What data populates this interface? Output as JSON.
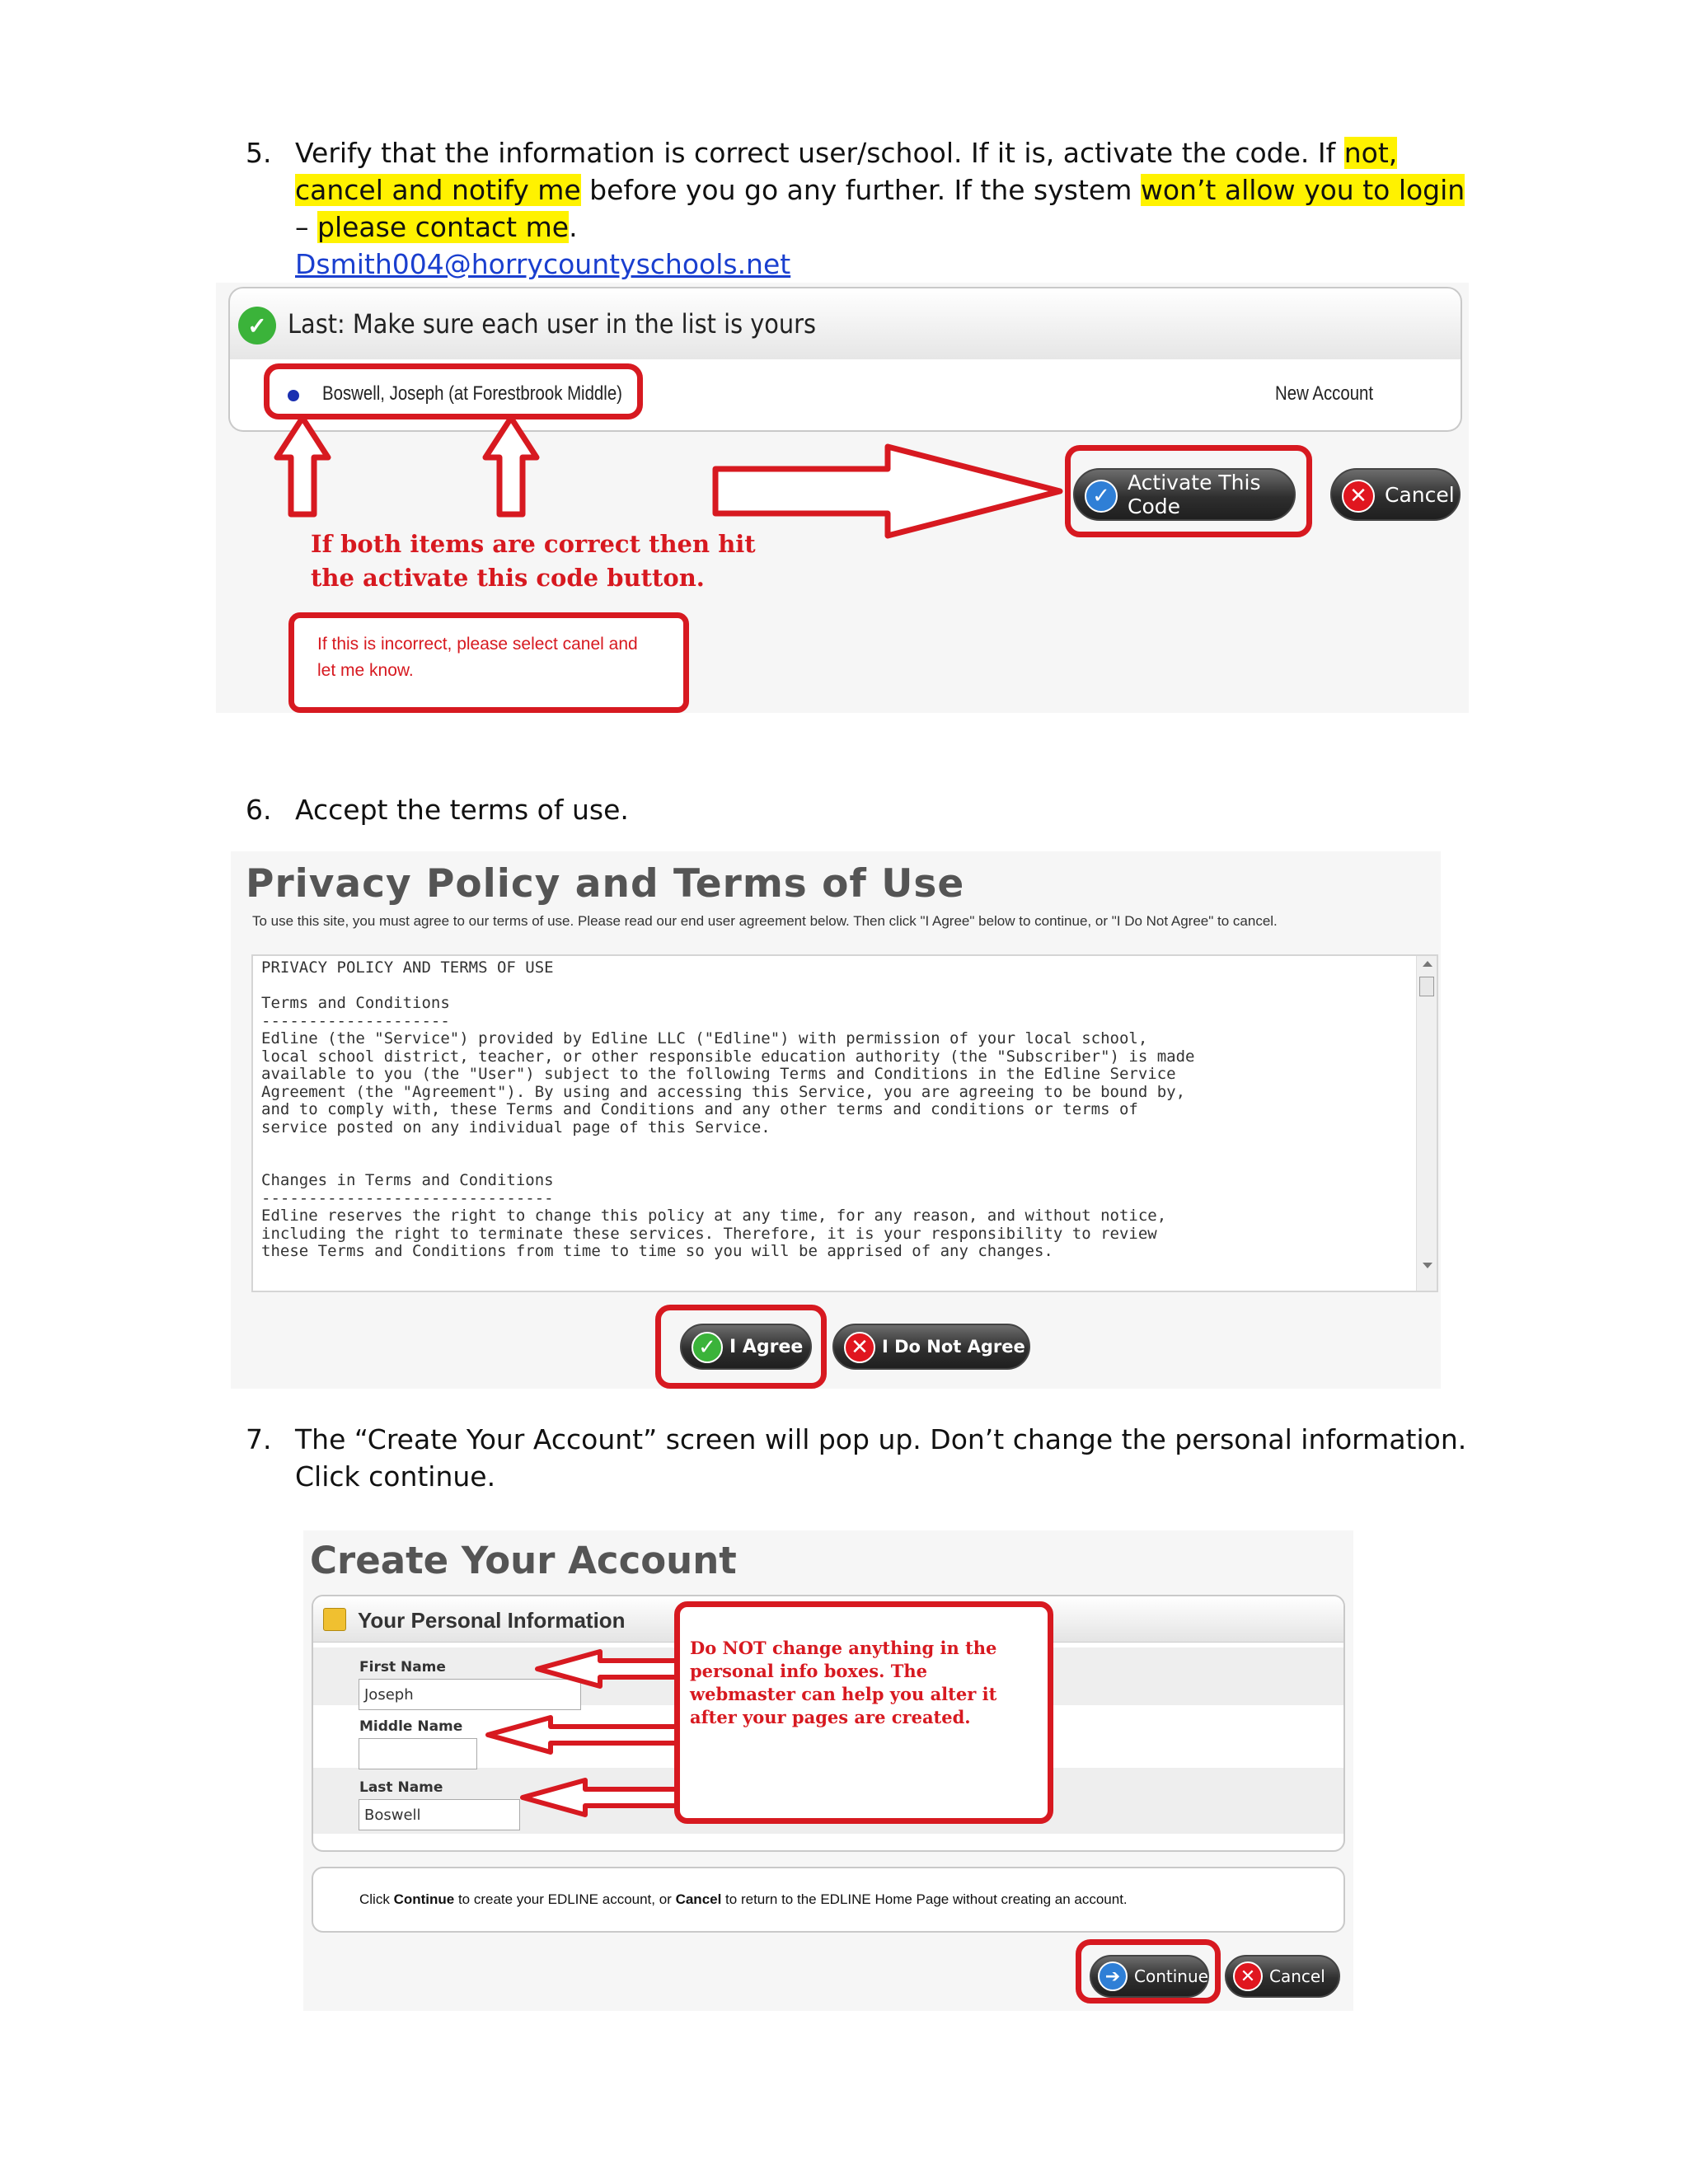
{
  "step5": {
    "number": "5.",
    "text_a": "Verify that the information is correct user/school.  If it is, activate the code. If ",
    "hl_a": "not, cancel and notify me",
    "text_b": " before you go any further. If the system ",
    "hl_b": "won’t allow you to login",
    "text_c": " – ",
    "hl_c": "please contact me",
    "text_d": ".",
    "email": "Dsmith004@horrycountyschools.net"
  },
  "shot1": {
    "header": "Last: Make sure each user in the list is yours",
    "user": "Boswell, Joseph (at Forestbrook Middle)",
    "status": "New Account",
    "activate_label": "Activate This Code",
    "cancel_label": "Cancel",
    "note_line1": "If both items are correct then hit",
    "note_line2": "the activate this code button.",
    "box_line1": "If  this is incorrect, please select canel and",
    "box_line2": "let me know."
  },
  "step6": {
    "number": "6.",
    "text": "Accept the terms of use."
  },
  "shot2": {
    "title": "Privacy Policy and Terms of Use",
    "intro": "To use this site, you must agree to our terms of use. Please read our end user agreement below. Then click \"I Agree\" below to continue, or \"I Do Not Agree\" to cancel.",
    "terms": "PRIVACY POLICY AND TERMS OF USE\n\nTerms and Conditions\n--------------------\nEdline (the \"Service\") provided by Edline LLC (\"Edline\") with permission of your local school,\nlocal school district, teacher, or other responsible education authority (the \"Subscriber\") is made\navailable to you (the \"User\") subject to the following Terms and Conditions in the Edline Service\nAgreement (the \"Agreement\"). By using and accessing this Service, you are agreeing to be bound by,\nand to comply with, these Terms and Conditions and any other terms and conditions or terms of\nservice posted on any individual page of this Service.\n\n\nChanges in Terms and Conditions\n-------------------------------\nEdline reserves the right to change this policy at any time, for any reason, and without notice,\nincluding the right to terminate these services. Therefore, it is your responsibility to review\nthese Terms and Conditions from time to time so you will be apprised of any changes.",
    "agree_label": "I Agree",
    "disagree_label": "I Do Not Agree"
  },
  "step7": {
    "number": "7.",
    "text": "The “Create Your Account” screen will pop up.  Don’t change the personal information. Click continue."
  },
  "shot3": {
    "title": "Create Your Account",
    "panel_title": "Your Personal Information",
    "first_name_label": "First Name",
    "first_name_value": "Joseph",
    "middle_name_label": "Middle Name",
    "middle_name_value": "",
    "last_name_label": "Last Name",
    "last_name_value": "Boswell",
    "note": "Do NOT change anything in the personal info boxes.  The webmaster can help you alter it after your pages are created.",
    "instr_a": "Click ",
    "instr_b": "Continue",
    "instr_c": " to create your EDLINE account, or ",
    "instr_d": "Cancel",
    "instr_e": " to return to the EDLINE Home Page without creating an account.",
    "continue_label": "Continue",
    "cancel_label": "Cancel"
  },
  "colors": {
    "highlight": "#fff200",
    "annotation_red": "#d71920",
    "link_blue": "#1a3fcf"
  }
}
